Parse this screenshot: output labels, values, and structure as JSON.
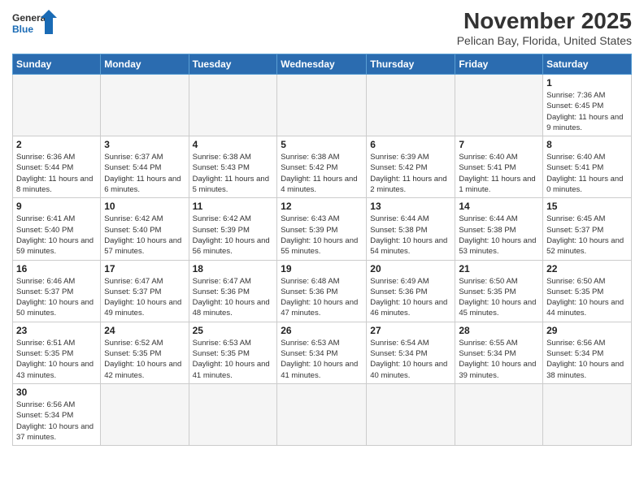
{
  "header": {
    "logo_general": "General",
    "logo_blue": "Blue",
    "month_title": "November 2025",
    "location": "Pelican Bay, Florida, United States"
  },
  "days_of_week": [
    "Sunday",
    "Monday",
    "Tuesday",
    "Wednesday",
    "Thursday",
    "Friday",
    "Saturday"
  ],
  "weeks": [
    [
      {
        "day": "",
        "info": ""
      },
      {
        "day": "",
        "info": ""
      },
      {
        "day": "",
        "info": ""
      },
      {
        "day": "",
        "info": ""
      },
      {
        "day": "",
        "info": ""
      },
      {
        "day": "",
        "info": ""
      },
      {
        "day": "1",
        "info": "Sunrise: 7:36 AM\nSunset: 6:45 PM\nDaylight: 11 hours and 9 minutes."
      }
    ],
    [
      {
        "day": "2",
        "info": "Sunrise: 6:36 AM\nSunset: 5:44 PM\nDaylight: 11 hours and 8 minutes."
      },
      {
        "day": "3",
        "info": "Sunrise: 6:37 AM\nSunset: 5:44 PM\nDaylight: 11 hours and 6 minutes."
      },
      {
        "day": "4",
        "info": "Sunrise: 6:38 AM\nSunset: 5:43 PM\nDaylight: 11 hours and 5 minutes."
      },
      {
        "day": "5",
        "info": "Sunrise: 6:38 AM\nSunset: 5:42 PM\nDaylight: 11 hours and 4 minutes."
      },
      {
        "day": "6",
        "info": "Sunrise: 6:39 AM\nSunset: 5:42 PM\nDaylight: 11 hours and 2 minutes."
      },
      {
        "day": "7",
        "info": "Sunrise: 6:40 AM\nSunset: 5:41 PM\nDaylight: 11 hours and 1 minute."
      },
      {
        "day": "8",
        "info": "Sunrise: 6:40 AM\nSunset: 5:41 PM\nDaylight: 11 hours and 0 minutes."
      }
    ],
    [
      {
        "day": "9",
        "info": "Sunrise: 6:41 AM\nSunset: 5:40 PM\nDaylight: 10 hours and 59 minutes."
      },
      {
        "day": "10",
        "info": "Sunrise: 6:42 AM\nSunset: 5:40 PM\nDaylight: 10 hours and 57 minutes."
      },
      {
        "day": "11",
        "info": "Sunrise: 6:42 AM\nSunset: 5:39 PM\nDaylight: 10 hours and 56 minutes."
      },
      {
        "day": "12",
        "info": "Sunrise: 6:43 AM\nSunset: 5:39 PM\nDaylight: 10 hours and 55 minutes."
      },
      {
        "day": "13",
        "info": "Sunrise: 6:44 AM\nSunset: 5:38 PM\nDaylight: 10 hours and 54 minutes."
      },
      {
        "day": "14",
        "info": "Sunrise: 6:44 AM\nSunset: 5:38 PM\nDaylight: 10 hours and 53 minutes."
      },
      {
        "day": "15",
        "info": "Sunrise: 6:45 AM\nSunset: 5:37 PM\nDaylight: 10 hours and 52 minutes."
      }
    ],
    [
      {
        "day": "16",
        "info": "Sunrise: 6:46 AM\nSunset: 5:37 PM\nDaylight: 10 hours and 50 minutes."
      },
      {
        "day": "17",
        "info": "Sunrise: 6:47 AM\nSunset: 5:37 PM\nDaylight: 10 hours and 49 minutes."
      },
      {
        "day": "18",
        "info": "Sunrise: 6:47 AM\nSunset: 5:36 PM\nDaylight: 10 hours and 48 minutes."
      },
      {
        "day": "19",
        "info": "Sunrise: 6:48 AM\nSunset: 5:36 PM\nDaylight: 10 hours and 47 minutes."
      },
      {
        "day": "20",
        "info": "Sunrise: 6:49 AM\nSunset: 5:36 PM\nDaylight: 10 hours and 46 minutes."
      },
      {
        "day": "21",
        "info": "Sunrise: 6:50 AM\nSunset: 5:35 PM\nDaylight: 10 hours and 45 minutes."
      },
      {
        "day": "22",
        "info": "Sunrise: 6:50 AM\nSunset: 5:35 PM\nDaylight: 10 hours and 44 minutes."
      }
    ],
    [
      {
        "day": "23",
        "info": "Sunrise: 6:51 AM\nSunset: 5:35 PM\nDaylight: 10 hours and 43 minutes."
      },
      {
        "day": "24",
        "info": "Sunrise: 6:52 AM\nSunset: 5:35 PM\nDaylight: 10 hours and 42 minutes."
      },
      {
        "day": "25",
        "info": "Sunrise: 6:53 AM\nSunset: 5:35 PM\nDaylight: 10 hours and 41 minutes."
      },
      {
        "day": "26",
        "info": "Sunrise: 6:53 AM\nSunset: 5:34 PM\nDaylight: 10 hours and 41 minutes."
      },
      {
        "day": "27",
        "info": "Sunrise: 6:54 AM\nSunset: 5:34 PM\nDaylight: 10 hours and 40 minutes."
      },
      {
        "day": "28",
        "info": "Sunrise: 6:55 AM\nSunset: 5:34 PM\nDaylight: 10 hours and 39 minutes."
      },
      {
        "day": "29",
        "info": "Sunrise: 6:56 AM\nSunset: 5:34 PM\nDaylight: 10 hours and 38 minutes."
      }
    ],
    [
      {
        "day": "30",
        "info": "Sunrise: 6:56 AM\nSunset: 5:34 PM\nDaylight: 10 hours and 37 minutes."
      },
      {
        "day": "",
        "info": ""
      },
      {
        "day": "",
        "info": ""
      },
      {
        "day": "",
        "info": ""
      },
      {
        "day": "",
        "info": ""
      },
      {
        "day": "",
        "info": ""
      },
      {
        "day": "",
        "info": ""
      }
    ]
  ]
}
